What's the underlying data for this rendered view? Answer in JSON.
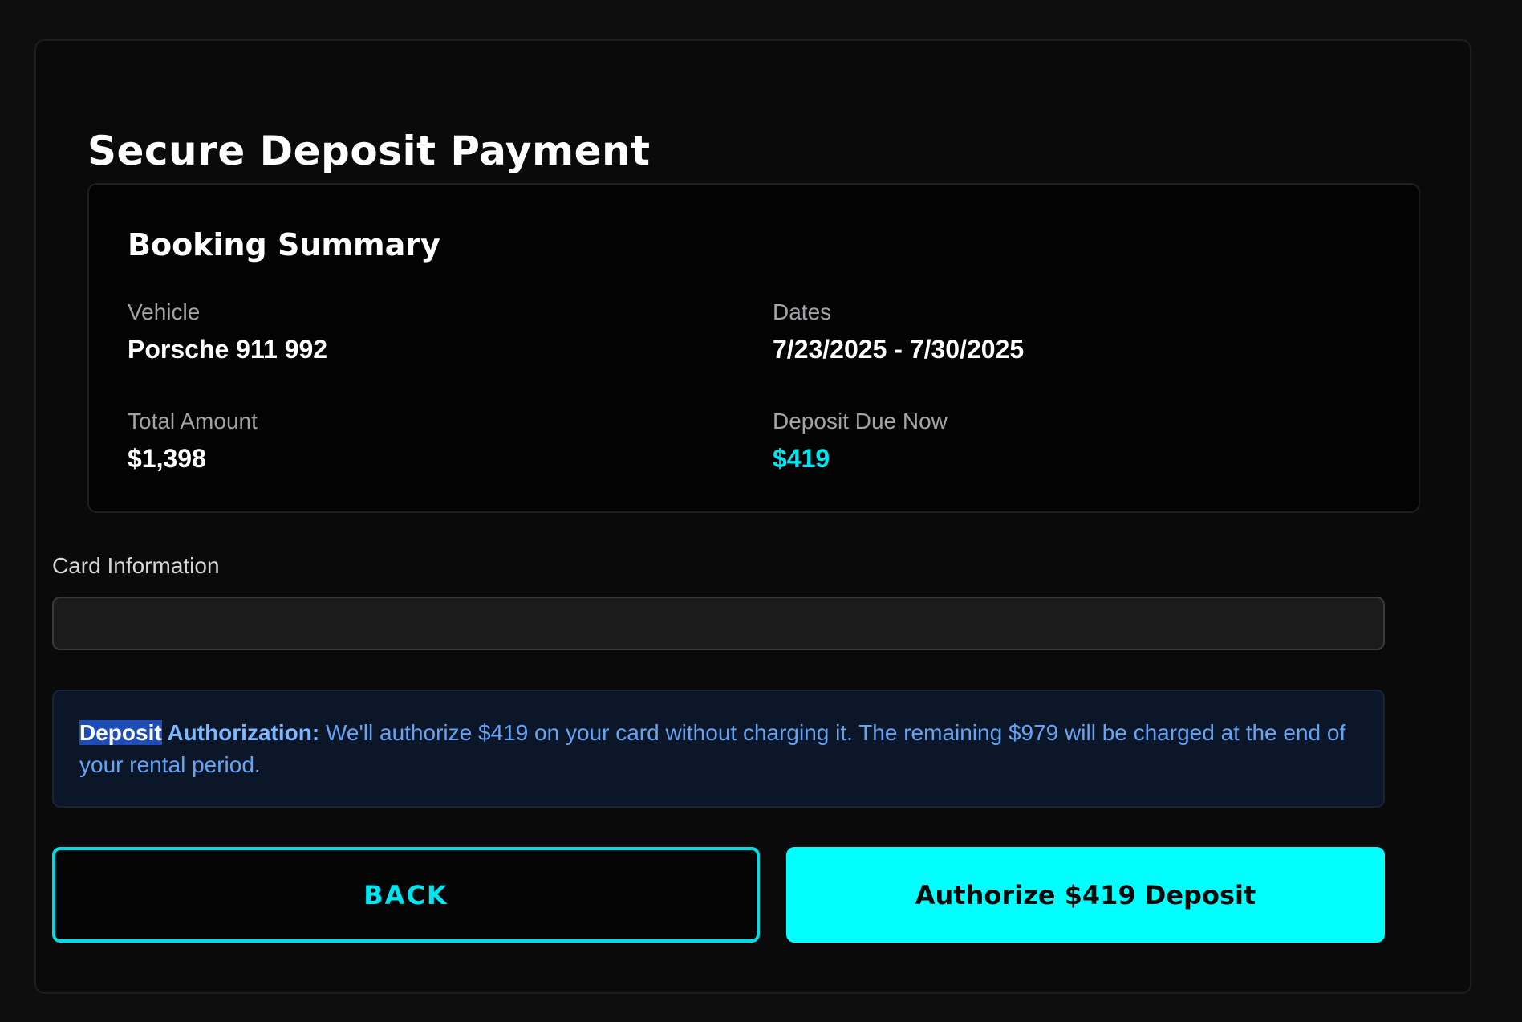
{
  "page": {
    "title": "Secure Deposit Payment"
  },
  "booking_summary": {
    "title": "Booking Summary",
    "vehicle_label": "Vehicle",
    "vehicle_value": "Porsche 911 992",
    "dates_label": "Dates",
    "dates_value": "7/23/2025 - 7/30/2025",
    "total_label": "Total Amount",
    "total_value": "$1,398",
    "deposit_label": "Deposit Due Now",
    "deposit_value": "$419"
  },
  "card": {
    "label": "Card Information",
    "value": ""
  },
  "notice": {
    "highlighted": "Deposit",
    "bold_rest": " Authorization:",
    "text": " We'll authorize $419 on your card without charging it. The remaining $979 will be charged at the end of your rental period."
  },
  "actions": {
    "back_label": "BACK",
    "authorize_label": "Authorize $419 Deposit"
  },
  "colors": {
    "accent": "#00ffff",
    "background": "#0a0a0a",
    "notice_text": "#66a3f2"
  }
}
